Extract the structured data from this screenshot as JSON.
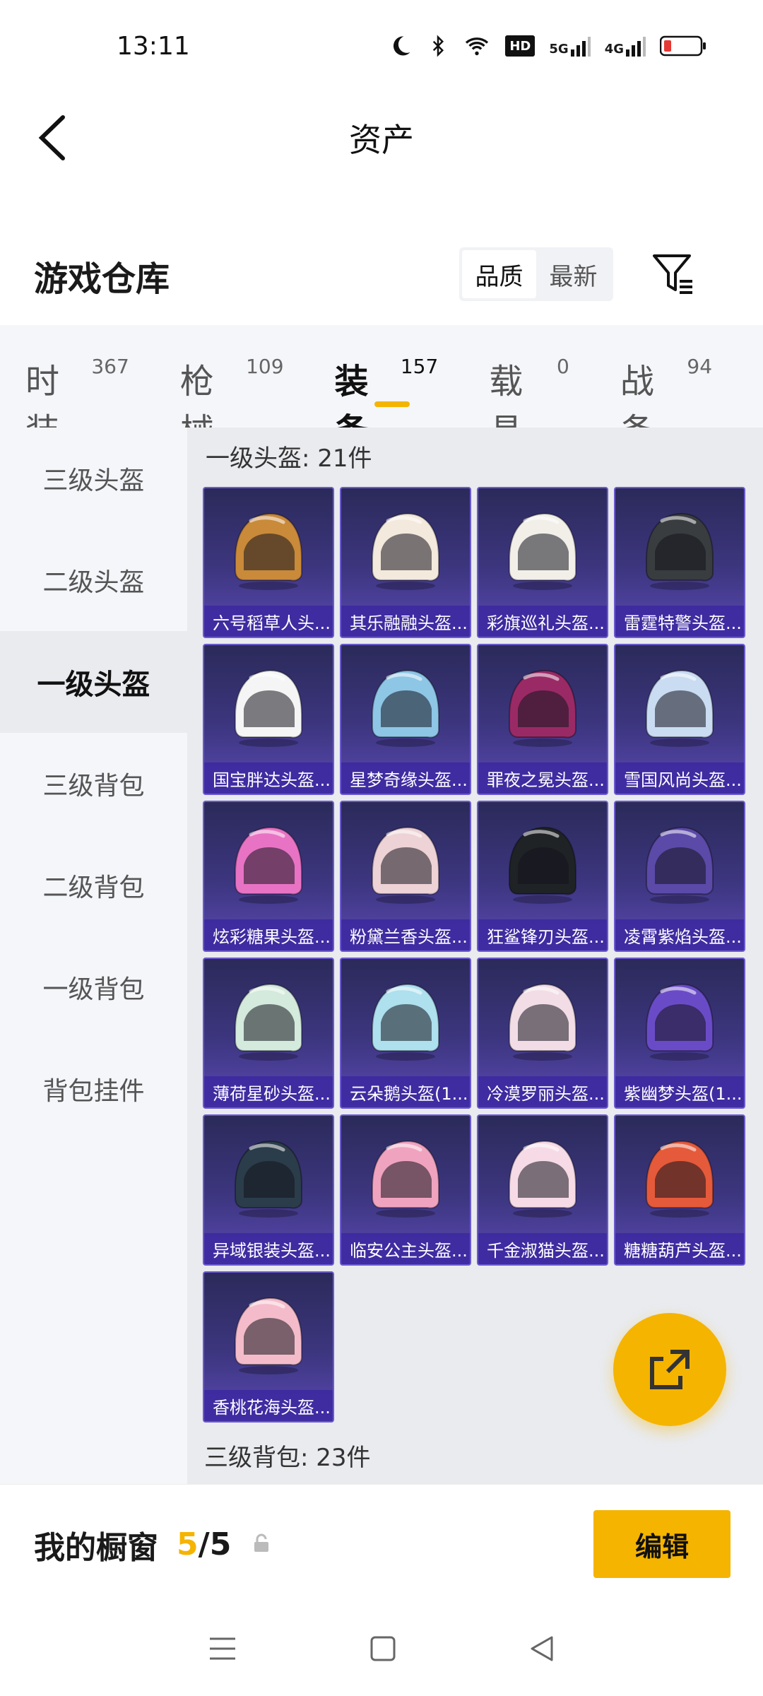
{
  "status_bar": {
    "time": "13:11",
    "icons": [
      "moon-icon",
      "bluetooth-icon",
      "wifi-icon",
      "hd-icon",
      "signal-5g-icon",
      "signal-4g-icon",
      "battery-icon"
    ],
    "hd_label": "HD",
    "net1": "5G",
    "net2": "4G"
  },
  "header": {
    "title": "资产",
    "back_icon": "chevron-left-icon"
  },
  "warehouse": {
    "title": "游戏仓库",
    "sort_options": [
      "品质",
      "最新"
    ],
    "active_sort": "品质",
    "filter_icon": "filter-list-icon"
  },
  "tabs": [
    {
      "label": "时装",
      "count": "367"
    },
    {
      "label": "枪械",
      "count": "109"
    },
    {
      "label": "装备",
      "count": "157",
      "active": true
    },
    {
      "label": "载具",
      "count": "0"
    },
    {
      "label": "战备",
      "count": "94"
    }
  ],
  "sidebar": [
    {
      "label": "三级头盔"
    },
    {
      "label": "二级头盔"
    },
    {
      "label": "一级头盔",
      "active": true
    },
    {
      "label": "三级背包"
    },
    {
      "label": "二级背包"
    },
    {
      "label": "一级背包"
    },
    {
      "label": "背包挂件"
    }
  ],
  "group_1": {
    "title": "一级头盔: 21件"
  },
  "items": [
    {
      "name": "六号稻草人头...",
      "color": "#c98a3a"
    },
    {
      "name": "其乐融融头盔...",
      "color": "#f3e9dc"
    },
    {
      "name": "彩旗巡礼头盔...",
      "color": "#f2efe9"
    },
    {
      "name": "雷霆特警头盔...",
      "color": "#3a3d3f"
    },
    {
      "name": "国宝胖达头盔...",
      "color": "#f5f5f5"
    },
    {
      "name": "星梦奇缘头盔...",
      "color": "#8ec6e6"
    },
    {
      "name": "罪夜之冕头盔...",
      "color": "#9a2a66"
    },
    {
      "name": "雪国风尚头盔...",
      "color": "#c9dcf2"
    },
    {
      "name": "炫彩糖果头盔...",
      "color": "#e873c4"
    },
    {
      "name": "粉黛兰香头盔...",
      "color": "#edd2d6"
    },
    {
      "name": "狂鲨锋刃头盔...",
      "color": "#1f2326"
    },
    {
      "name": "凌霄紫焰头盔...",
      "color": "#5b4aa8"
    },
    {
      "name": "薄荷星砂头盔...",
      "color": "#d3eadc"
    },
    {
      "name": "云朵鹅头盔(1...",
      "color": "#aee0ee"
    },
    {
      "name": "冷漠罗丽头盔...",
      "color": "#f2dde6"
    },
    {
      "name": "紫幽梦头盔(1...",
      "color": "#6a4bc7"
    },
    {
      "name": "异域银装头盔...",
      "color": "#2b3d4a"
    },
    {
      "name": "临安公主头盔...",
      "color": "#f0a3bf"
    },
    {
      "name": "千金淑猫头盔...",
      "color": "#f6dbe6"
    },
    {
      "name": "糖糖葫芦头盔...",
      "color": "#e55a3a"
    },
    {
      "name": "香桃花海头盔...",
      "color": "#f4bcca"
    }
  ],
  "group_2": {
    "title": "三级背包: 23件"
  },
  "fab": {
    "icon": "share-external-icon"
  },
  "showcase": {
    "title": "我的橱窗",
    "current": "5",
    "separator": "/",
    "max": "5",
    "lock_icon": "lock-icon",
    "edit_label": "编辑"
  },
  "nav_bar": {
    "icons": [
      "menu-icon",
      "home-square-icon",
      "back-triangle-icon"
    ]
  }
}
